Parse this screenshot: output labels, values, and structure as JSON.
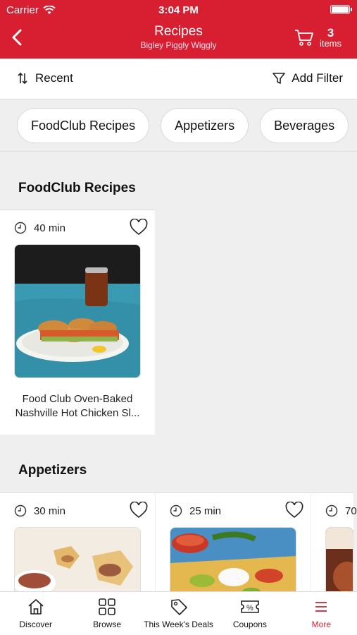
{
  "status_bar": {
    "carrier": "Carrier",
    "time": "3:04 PM"
  },
  "header": {
    "title": "Recipes",
    "subtitle": "Bigley Piggly Wiggly",
    "cart_count": "3",
    "cart_label": "items"
  },
  "toolbar": {
    "sort_label": "Recent",
    "filter_label": "Add Filter"
  },
  "chips": [
    "FoodClub Recipes",
    "Appetizers",
    "Beverages"
  ],
  "sections": [
    {
      "title": "FoodClub Recipes",
      "cards": [
        {
          "time": "40 min",
          "title": "Food Club Oven-Baked Nashville Hot Chicken Sl..."
        }
      ]
    },
    {
      "title": "Appetizers",
      "cards": [
        {
          "time": "30 min"
        },
        {
          "time": "25 min"
        },
        {
          "time": "70"
        }
      ]
    }
  ],
  "tabs": [
    {
      "label": "Discover",
      "icon": "home-icon"
    },
    {
      "label": "Browse",
      "icon": "grid-icon"
    },
    {
      "label": "This Week's Deals",
      "icon": "tag-icon"
    },
    {
      "label": "Coupons",
      "icon": "coupon-icon"
    },
    {
      "label": "More",
      "icon": "menu-icon",
      "active": true
    }
  ],
  "colors": {
    "brand": "#d81f32"
  }
}
